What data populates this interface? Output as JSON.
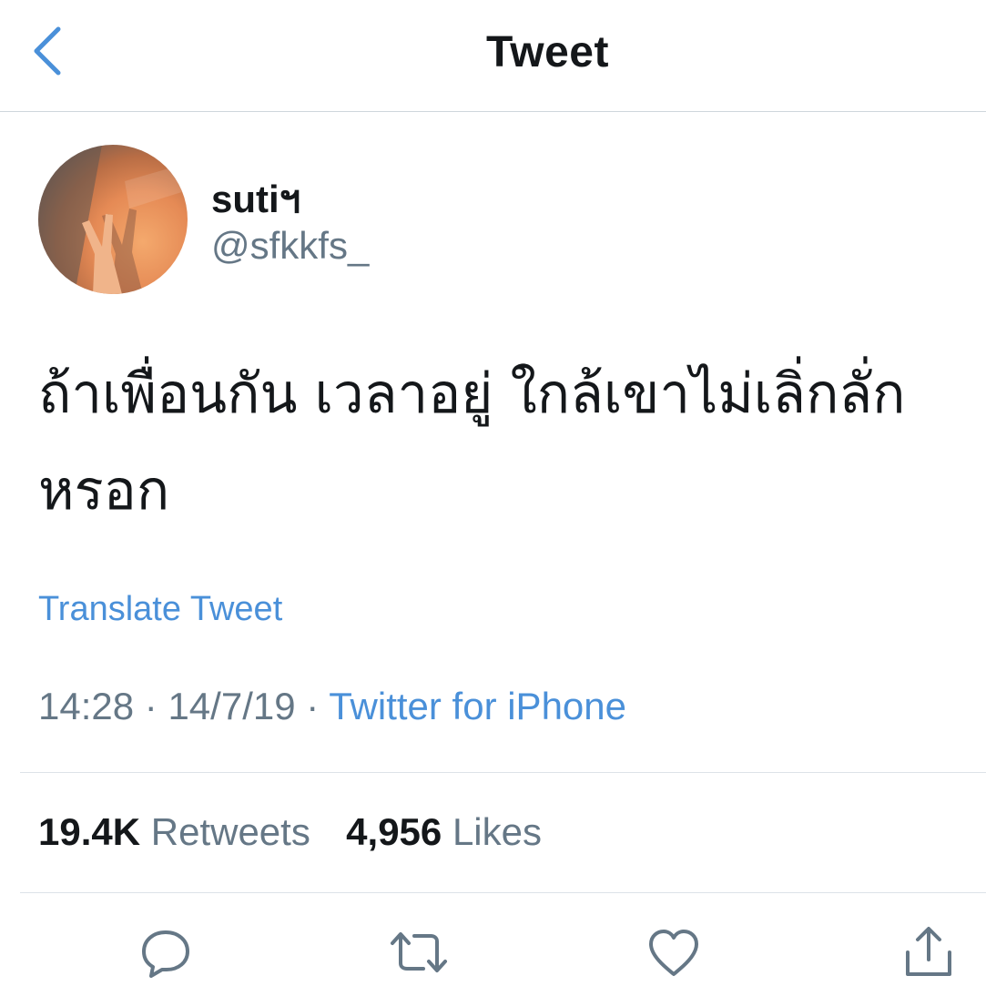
{
  "nav": {
    "title": "Tweet"
  },
  "author": {
    "display_name": "sutiฯ",
    "handle": "@sfkkfs_"
  },
  "tweet": {
    "text_line1": "ถ้าเพื่อนกัน เวลาอยู่ ใกล้เขาไม่เลิ่กลั่ก",
    "text_line2": "หรอก",
    "translate_label": "Translate Tweet",
    "time": "14:28",
    "date": "14/7/19",
    "separator": "·",
    "source": "Twitter for iPhone"
  },
  "stats": {
    "retweets_count": "19.4K",
    "retweets_label": "Retweets",
    "likes_count": "4,956",
    "likes_label": "Likes"
  },
  "icons": {
    "back": "chevron-left-icon",
    "reply": "reply-icon",
    "retweet": "retweet-icon",
    "like": "heart-icon",
    "share": "share-icon"
  },
  "colors": {
    "accent": "#4a90d9",
    "secondary_text": "#657786",
    "primary_text": "#14171a"
  }
}
